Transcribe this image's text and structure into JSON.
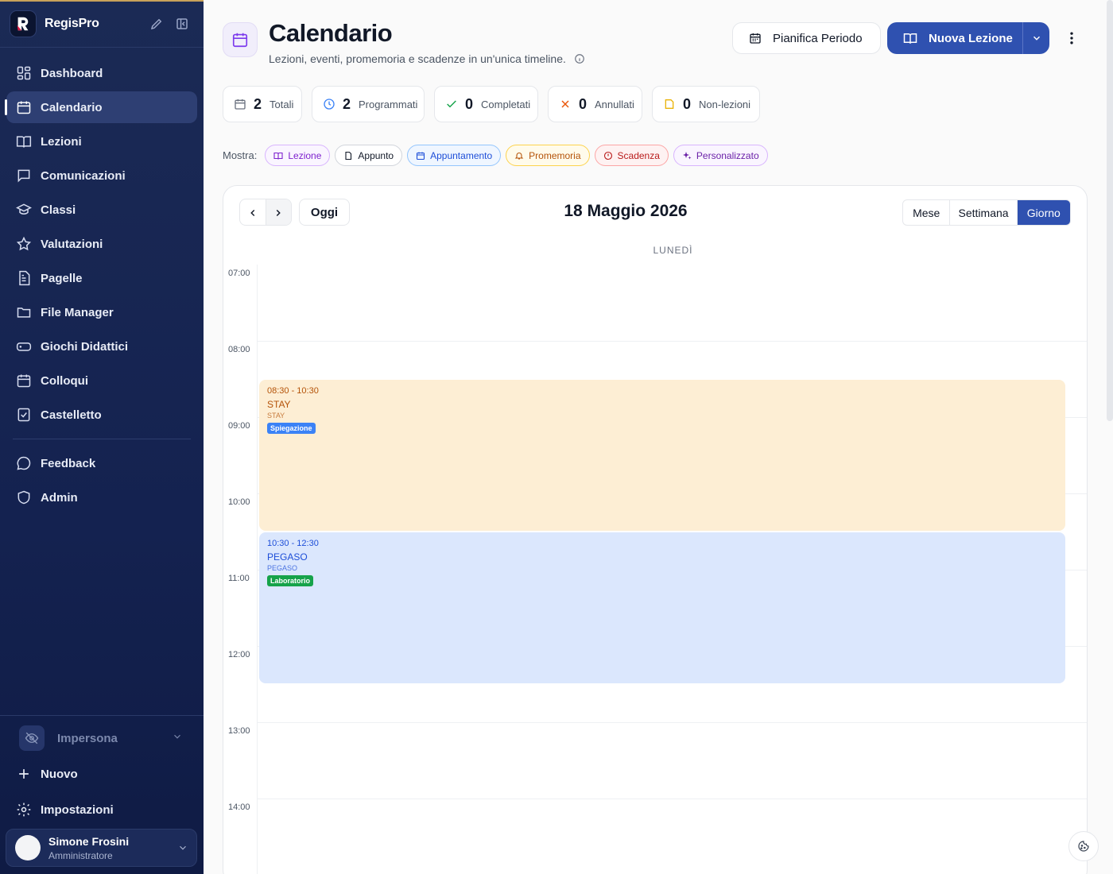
{
  "app": {
    "name": "RegisPro"
  },
  "sidebar": {
    "items": [
      {
        "label": "Dashboard",
        "icon": "dashboard-icon"
      },
      {
        "label": "Calendario",
        "icon": "calendar-icon",
        "active": true
      },
      {
        "label": "Lezioni",
        "icon": "book-open-icon"
      },
      {
        "label": "Comunicazioni",
        "icon": "message-icon"
      },
      {
        "label": "Classi",
        "icon": "graduation-cap-icon"
      },
      {
        "label": "Valutazioni",
        "icon": "star-icon"
      },
      {
        "label": "Pagelle",
        "icon": "report-icon"
      },
      {
        "label": "File Manager",
        "icon": "folder-icon"
      },
      {
        "label": "Giochi Didattici",
        "icon": "gamepad-icon"
      },
      {
        "label": "Colloqui",
        "icon": "calendar-icon"
      },
      {
        "label": "Castelletto",
        "icon": "checklist-icon"
      }
    ],
    "secondary": [
      {
        "label": "Feedback",
        "icon": "chat-bubble-icon"
      },
      {
        "label": "Admin",
        "icon": "shield-icon"
      }
    ],
    "impersona": "Impersona",
    "nuovo": "Nuovo",
    "impostazioni": "Impostazioni",
    "user": {
      "name": "Simone Frosini",
      "role": "Amministratore"
    }
  },
  "header": {
    "title": "Calendario",
    "subtitle": "Lezioni, eventi, promemoria e scadenze in un'unica timeline.",
    "plan_button": "Pianifica Periodo",
    "new_button": "Nuova Lezione"
  },
  "stats": [
    {
      "value": "2",
      "label": "Totali",
      "icon": "calendar-icon",
      "color": "#6b7280"
    },
    {
      "value": "2",
      "label": "Programmati",
      "icon": "clock-icon",
      "color": "#3b82f6"
    },
    {
      "value": "0",
      "label": "Completati",
      "icon": "check-icon",
      "color": "#16a34a"
    },
    {
      "value": "0",
      "label": "Annullati",
      "icon": "x-icon",
      "color": "#ea580c"
    },
    {
      "value": "0",
      "label": "Non-lezioni",
      "icon": "note-icon",
      "color": "#eab308"
    }
  ],
  "filters": {
    "label": "Mostra:",
    "chips": [
      {
        "label": "Lezione",
        "icon": "book-open-icon",
        "color": "#7e22ce",
        "border": "#d8b4fe",
        "bg": "#faf5ff"
      },
      {
        "label": "Appunto",
        "icon": "note-icon",
        "color": "#111827",
        "border": "#d1d5db",
        "bg": "#ffffff"
      },
      {
        "label": "Appuntamento",
        "icon": "calendar-icon",
        "color": "#1d4ed8",
        "border": "#93c5fd",
        "bg": "#eff6ff"
      },
      {
        "label": "Promemoria",
        "icon": "bell-icon",
        "color": "#b45309",
        "border": "#fcd34d",
        "bg": "#fffbeb"
      },
      {
        "label": "Scadenza",
        "icon": "alert-circle-icon",
        "color": "#b91c1c",
        "border": "#fca5a5",
        "bg": "#fef2f2"
      },
      {
        "label": "Personalizzato",
        "icon": "sparkles-icon",
        "color": "#6b21a8",
        "border": "#d8b4fe",
        "bg": "#faf5ff"
      }
    ]
  },
  "calendar": {
    "today_button": "Oggi",
    "date_label": "18 Maggio 2026",
    "views": [
      "Mese",
      "Settimana",
      "Giorno"
    ],
    "active_view": "Giorno",
    "day_name": "LUNEDÌ",
    "hours": [
      "07:00",
      "08:00",
      "09:00",
      "10:00",
      "11:00",
      "12:00",
      "13:00",
      "14:00"
    ],
    "events": [
      {
        "time": "08:30 - 10:30",
        "title": "STAY",
        "subtitle": "STAY",
        "tag": "Spiegazione",
        "start_hour": 8.5,
        "end_hour": 10.5,
        "bg": "#fdeed4",
        "text": "#b45309",
        "tag_color": "#3b82f6"
      },
      {
        "time": "10:30 - 12:30",
        "title": "PEGASO",
        "subtitle": "PEGASO",
        "tag": "Laboratorio",
        "start_hour": 10.5,
        "end_hour": 12.5,
        "bg": "#dbe7fd",
        "text": "#1d4ed8",
        "tag_color": "#16a34a"
      }
    ]
  }
}
